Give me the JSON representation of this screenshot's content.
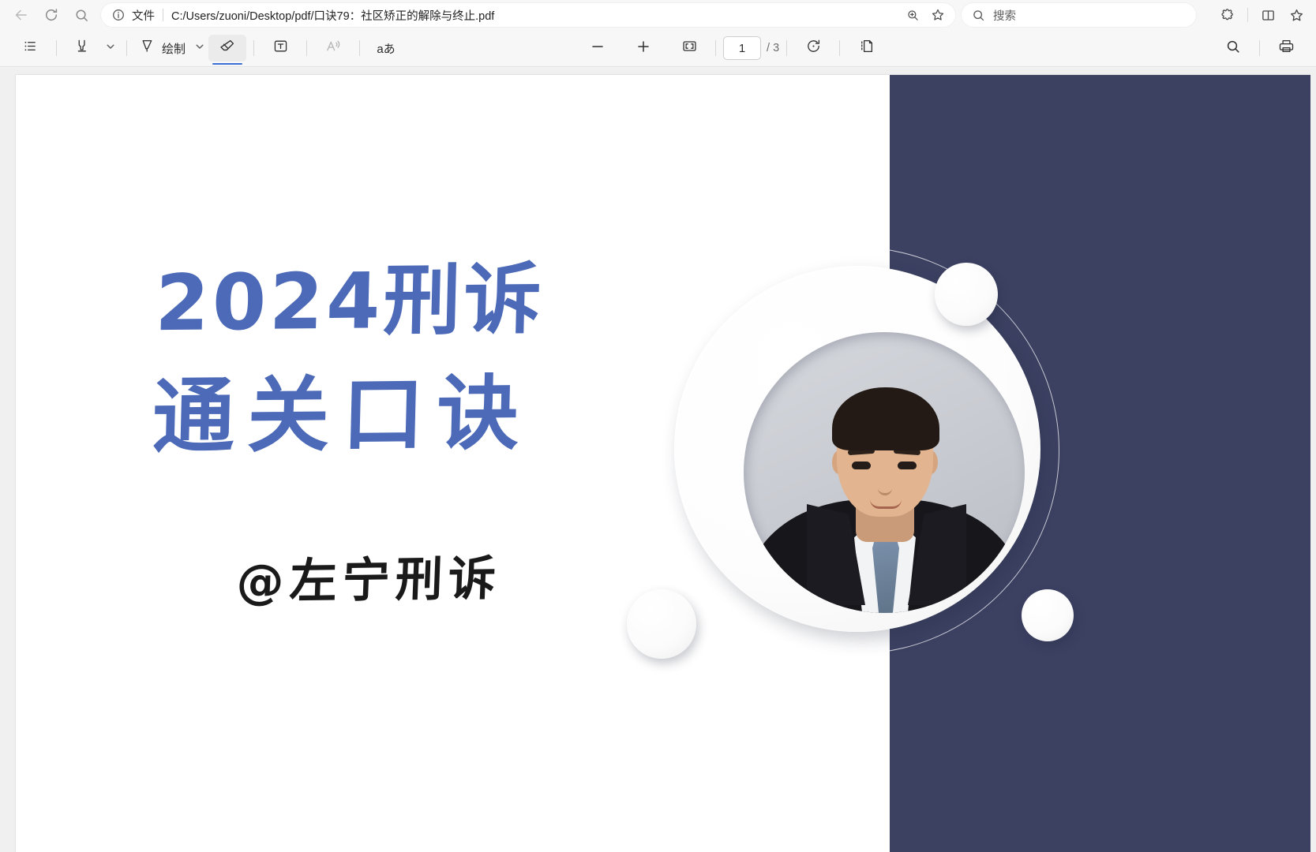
{
  "browser": {
    "back_icon": "back-arrow-icon",
    "reload_icon": "reload-icon",
    "search_page_icon": "search-icon",
    "omnibox": {
      "info_icon": "info-circle-icon",
      "scheme_label": "文件",
      "url": "C:/Users/zuoni/Desktop/pdf/口诀79：社区矫正的解除与终止.pdf",
      "zoom_icon": "zoom-in-icon",
      "favorite_icon": "star-icon"
    },
    "search": {
      "icon": "search-icon",
      "placeholder": "搜索",
      "value": ""
    },
    "right_icons": [
      {
        "name": "extensions-icon",
        "label": "扩展"
      },
      {
        "name": "split-screen-icon",
        "label": "拆分屏幕"
      },
      {
        "name": "favorites-star-icon",
        "label": "收藏夹"
      }
    ]
  },
  "pdf_toolbar": {
    "outline_label": "大纲",
    "highlight_label": "荧光笔",
    "draw_label": "绘制",
    "erase_label": "擦除",
    "textbox_label": "文本",
    "read_aloud_label": "朗读",
    "translate_label": "aあ",
    "zoom_out_label": "缩小",
    "zoom_in_label": "放大",
    "fit_page_label": "适应页面",
    "page_value": "1",
    "page_total": "/ 3",
    "rotate_label": "旋转",
    "page_view_label": "页面视图",
    "find_label": "查找",
    "print_label": "打印",
    "active_tool": "erase",
    "accent_color": "#3b6fd4"
  },
  "document": {
    "file_name": "口诀79：社区矫正的解除与终止.pdf",
    "page_number": 1,
    "page_count": 3,
    "slide": {
      "title_line1": "2024刑诉",
      "title_line2": "通关口诀",
      "handle": "@左宁刑诉",
      "title_color": "#4c6ab8",
      "handle_color": "#1a1a1a",
      "panel_color": "#3c4162",
      "page_background": "#ffffff",
      "portrait_alt": "讲师头像"
    }
  }
}
